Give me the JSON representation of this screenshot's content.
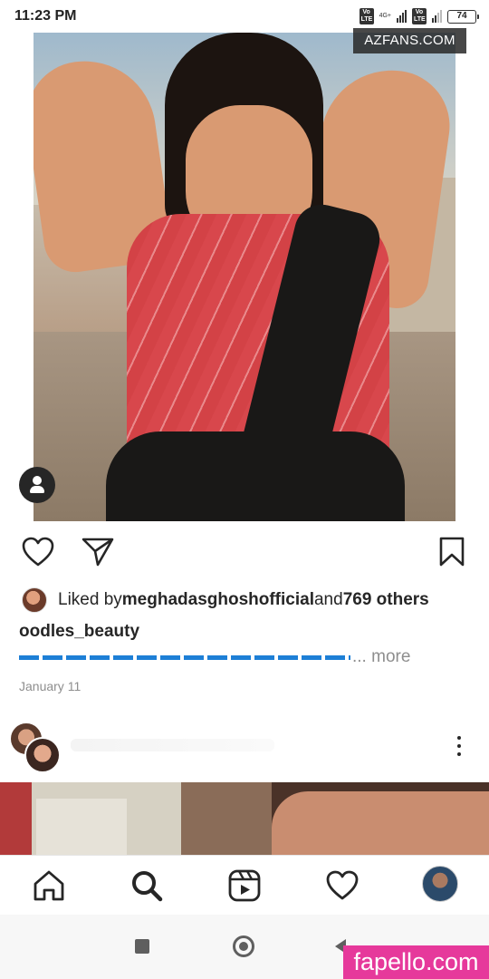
{
  "status_bar": {
    "time": "11:23 PM",
    "sim1_label": "Vo LTE",
    "sim1_network": "4G+",
    "sim2_label": "Vo LTE",
    "battery": "74"
  },
  "post": {
    "watermark_top": "AZFANS.COM",
    "liked_prefix": "Liked by ",
    "liked_user": "meghadasghoshofficial",
    "liked_and": " and ",
    "liked_others": "769 others",
    "caption_username": "oodles_beauty",
    "more_label": "... more",
    "date": "January 11"
  },
  "watermark_bottom": "fapello.com",
  "icons": {
    "like": "heart-icon",
    "share": "send-icon",
    "save": "bookmark-icon",
    "tag": "user-tag-icon",
    "more": "more-vertical-icon",
    "home": "home-icon",
    "search": "search-icon",
    "reels": "reels-icon",
    "activity": "heart-icon"
  },
  "colors": {
    "link_blue": "#1d7fd6",
    "muted_text": "#8e8e8e",
    "watermark_pink": "#e6399b"
  }
}
